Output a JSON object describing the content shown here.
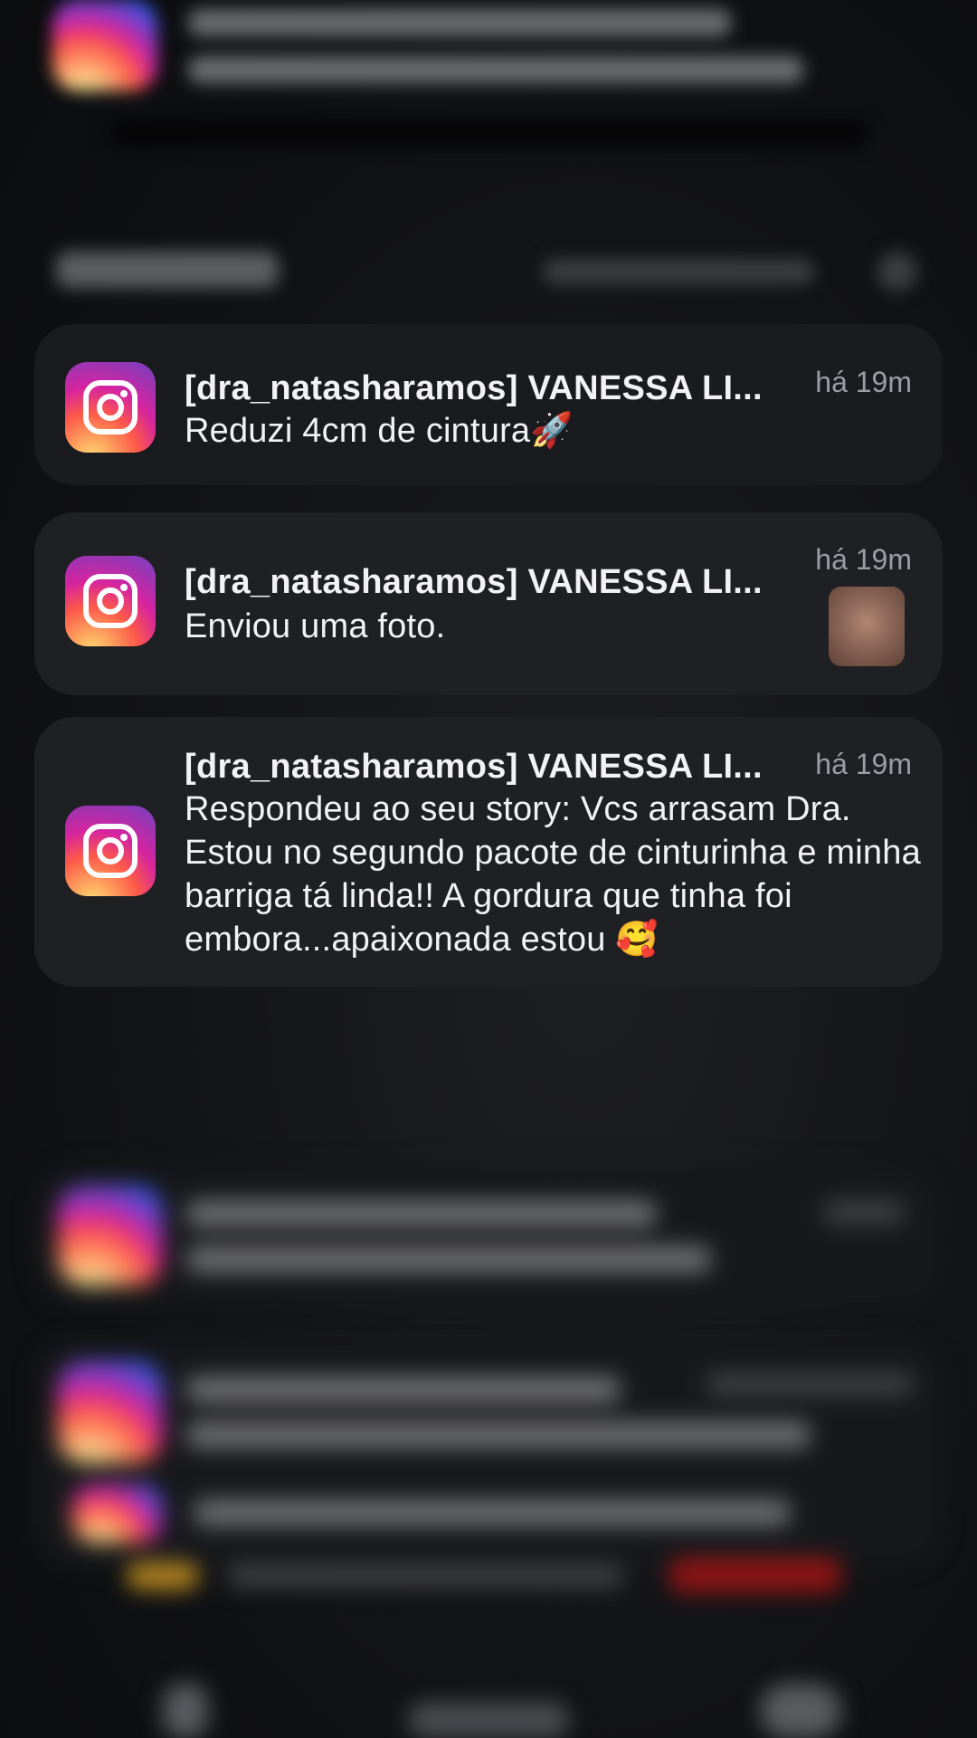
{
  "notifications": [
    {
      "title": "[dra_natasharamos] VANESSA LI...",
      "time": "há 19m",
      "body": "Reduzi 4cm de cintura🚀"
    },
    {
      "title": "[dra_natasharamos] VANESSA LI...",
      "time": "há 19m",
      "body": "Enviou uma foto."
    },
    {
      "title": "[dra_natasharamos] VANESSA LI...",
      "time": "há 19m",
      "body": "Respondeu ao seu story: Vcs arrasam Dra. Estou no segundo pacote de cinturinha e minha barriga tá linda!! A gordura que tinha foi embora...apaixonada estou 🥰"
    }
  ],
  "icons": {
    "app": "instagram-icon",
    "photo": "photo-thumbnail"
  },
  "colors": {
    "background": "#111215",
    "card": "#1f2023",
    "text": "#f2f2f4",
    "time": "#9c9ca2"
  }
}
